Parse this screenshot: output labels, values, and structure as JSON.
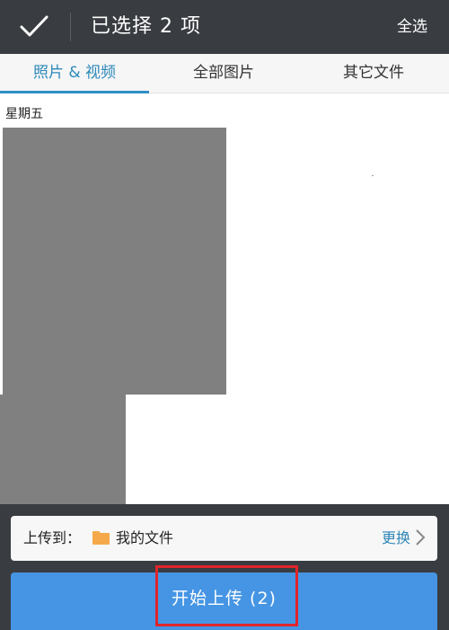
{
  "header": {
    "title": "已选择 2 项",
    "select_all_label": "全选"
  },
  "tabs": [
    {
      "label": "照片 & 视频",
      "active": true
    },
    {
      "label": "全部图片",
      "active": false
    },
    {
      "label": "其它文件",
      "active": false
    }
  ],
  "content": {
    "date_label": "星期五"
  },
  "upload_destination": {
    "prefix": "上传到：",
    "folder_name": "我的文件",
    "change_label": "更换"
  },
  "upload_button": {
    "label": "开始上传 (2)"
  },
  "colors": {
    "topbar": "#393c40",
    "accent": "#2f8fc4",
    "upload_button": "#4695e4",
    "highlight": "#e0242b",
    "folder": "#f5a94a"
  },
  "icons": {
    "confirm": "checkmark-icon",
    "folder": "folder-icon",
    "change": "chevron-right-icon"
  }
}
